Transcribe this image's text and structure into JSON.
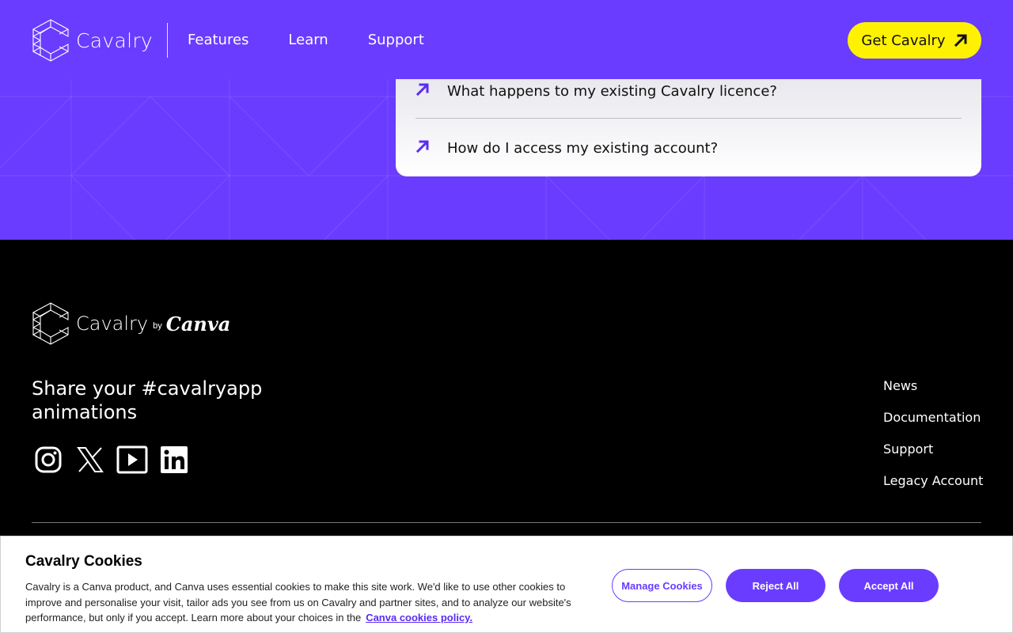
{
  "header": {
    "logo_text": "Cavalry",
    "nav": [
      "Features",
      "Learn",
      "Support"
    ],
    "cta_label": "Get Cavalry",
    "accent_color": "#6a3cff",
    "cta_color": "#fff200"
  },
  "faq": {
    "items": [
      {
        "question": "What happens to my existing Cavalry licence?",
        "icon": "arrow-up-right-icon"
      },
      {
        "question": "How do I access my existing account?",
        "icon": "arrow-up-right-icon"
      }
    ]
  },
  "footer": {
    "logo_text": "Cavalry",
    "by_text": "by",
    "partner_text": "Canva",
    "share_text": "Share your #cavalryapp animations",
    "socials": [
      "instagram-icon",
      "x-icon",
      "youtube-icon",
      "linkedin-icon"
    ],
    "links": [
      "News",
      "Documentation",
      "Support",
      "Legacy Account"
    ]
  },
  "cookie_banner": {
    "title": "Cavalry Cookies",
    "body": "Cavalry is a Canva product, and Canva uses essential cookies to make this site work. We'd like to use other cookies to improve and personalise your visit, tailor ads you see from us on Cavalry and partner sites, and to analyze our website's performance, but only if you accept. Learn more about your choices in the",
    "policy_link": "Canva cookies policy.",
    "manage_label": "Manage Cookies",
    "reject_label": "Reject All",
    "accept_label": "Accept All"
  }
}
